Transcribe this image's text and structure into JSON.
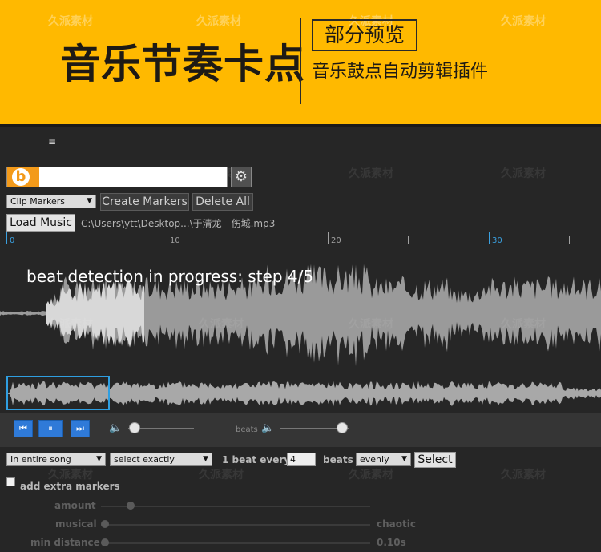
{
  "banner": {
    "title": "音乐节奏卡点",
    "badge": "部分预览",
    "subtitle": "音乐鼓点自动剪辑插件",
    "watermark": "久派素材",
    "background": "#ffb900"
  },
  "panel": {
    "menu_icon": "≡",
    "logo_letter": "b",
    "logo_color": "#f39a1a",
    "gear_icon": "⚙",
    "markers_select": "Clip Markers",
    "create_markers": "Create Markers",
    "delete_all": "Delete All",
    "load_music": "Load Music",
    "file_path": "C:\\Users\\ytt\\Desktop...\\于清龙 - 伤城.mp3",
    "ruler_labels": [
      "0",
      "10",
      "20",
      "30"
    ],
    "progress_text": "beat detection in progress: step 4/5",
    "accent": "#2f9ee0"
  },
  "transport": {
    "prev_icon": "skip-back-icon",
    "pause_icon": "pause-icon",
    "next_icon": "skip-forward-icon",
    "beats_label": "beats",
    "volume_level": 0.1,
    "beats_level": 0.9
  },
  "options": {
    "range_select": "In entire song",
    "mode_select": "select exactly",
    "every_prefix": "1 beat every",
    "every_value": "4",
    "every_suffix": "beats",
    "distribution_select": "evenly",
    "select_button": "Select",
    "extra_markers_label": "add extra markers",
    "amount_label": "amount",
    "musical_label": "musical",
    "musical_right": "chaotic",
    "min_distance_label": "min distance",
    "min_distance_value": "0.10s"
  }
}
